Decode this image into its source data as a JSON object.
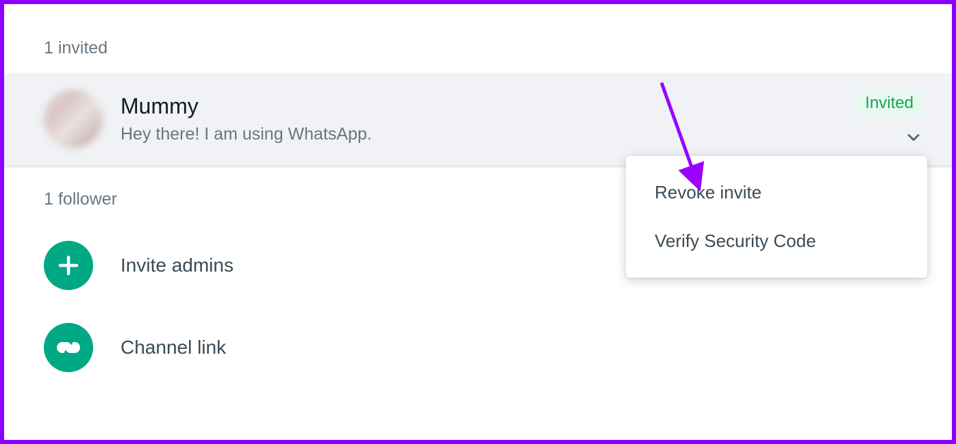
{
  "sections": {
    "invited_header": "1 invited",
    "follower_header": "1 follower"
  },
  "contact": {
    "name": "Mummy",
    "status": "Hey there! I am using WhatsApp.",
    "badge": "Invited"
  },
  "dropdown": {
    "revoke": "Revoke invite",
    "verify": "Verify Security Code"
  },
  "actions": {
    "invite_admins": "Invite admins",
    "channel_link": "Channel link"
  }
}
